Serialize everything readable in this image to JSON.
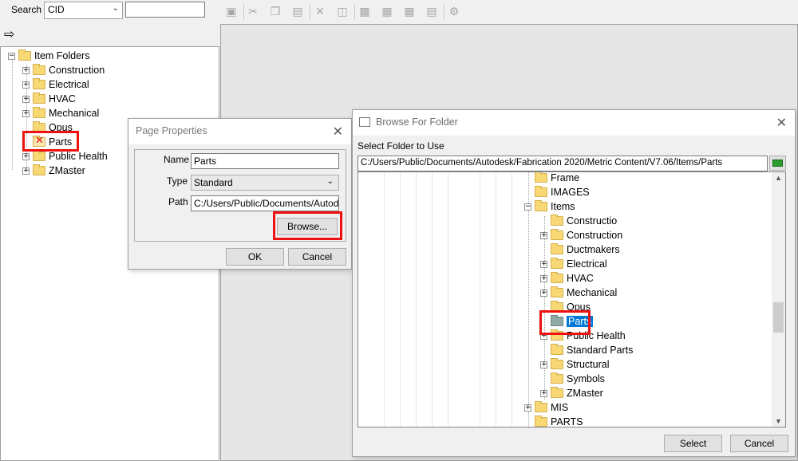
{
  "search": {
    "label": "Search",
    "combo_value": "CID",
    "input_value": ""
  },
  "left_tree": {
    "root": "Item Folders",
    "items": [
      {
        "label": "Construction",
        "expandable": true
      },
      {
        "label": "Electrical",
        "expandable": true
      },
      {
        "label": "HVAC",
        "expandable": true
      },
      {
        "label": "Mechanical",
        "expandable": true
      },
      {
        "label": "Opus",
        "expandable": false
      },
      {
        "label": "Parts",
        "expandable": false,
        "broken": true
      },
      {
        "label": "Public Health",
        "expandable": true
      },
      {
        "label": "ZMaster",
        "expandable": true
      }
    ]
  },
  "toolbar": {
    "icons": [
      "camera-icon",
      "cut-icon",
      "copy-icon",
      "paste-icon",
      "delete-icon",
      "properties-icon",
      "view1-icon",
      "view2-icon",
      "grid-icon",
      "table-icon",
      "settings-icon"
    ]
  },
  "page_properties": {
    "title": "Page Properties",
    "name_label": "Name",
    "name_value": "Parts",
    "type_label": "Type",
    "type_value": "Standard",
    "path_label": "Path",
    "path_value": "C:/Users/Public/Documents/Autodesk",
    "browse_button": "Browse...",
    "ok_button": "OK",
    "cancel_button": "Cancel"
  },
  "browse": {
    "title": "Browse For Folder",
    "prompt": "Select Folder to Use",
    "path_value": "C:/Users/Public/Documents/Autodesk/Fabrication 2020/Metric Content/V7.06/Items/Parts",
    "tree": [
      {
        "label": "Frame",
        "toggle": "",
        "level": 0
      },
      {
        "label": "IMAGES",
        "toggle": "",
        "level": 0
      },
      {
        "label": "Items",
        "toggle": "−",
        "level": 0
      },
      {
        "label": "Constructio",
        "toggle": "",
        "level": 1
      },
      {
        "label": "Construction",
        "toggle": "+",
        "level": 1
      },
      {
        "label": "Ductmakers",
        "toggle": "",
        "level": 1
      },
      {
        "label": "Electrical",
        "toggle": "+",
        "level": 1
      },
      {
        "label": "HVAC",
        "toggle": "+",
        "level": 1
      },
      {
        "label": "Mechanical",
        "toggle": "+",
        "level": 1
      },
      {
        "label": "Opus",
        "toggle": "",
        "level": 1
      },
      {
        "label": "Parts",
        "toggle": "",
        "level": 1,
        "selected": true
      },
      {
        "label": "Public Health",
        "toggle": "+",
        "level": 1
      },
      {
        "label": "Standard Parts",
        "toggle": "",
        "level": 1
      },
      {
        "label": "Structural",
        "toggle": "+",
        "level": 1
      },
      {
        "label": "Symbols",
        "toggle": "",
        "level": 1
      },
      {
        "label": "ZMaster",
        "toggle": "+",
        "level": 1
      },
      {
        "label": "MIS",
        "toggle": "+",
        "level": 0
      },
      {
        "label": "PARTS",
        "toggle": "",
        "level": 0
      }
    ],
    "select_button": "Select",
    "cancel_button": "Cancel"
  },
  "colors": {
    "highlight_box": "#e11111",
    "selection": "#0078d7",
    "folder": "#f8d775"
  }
}
